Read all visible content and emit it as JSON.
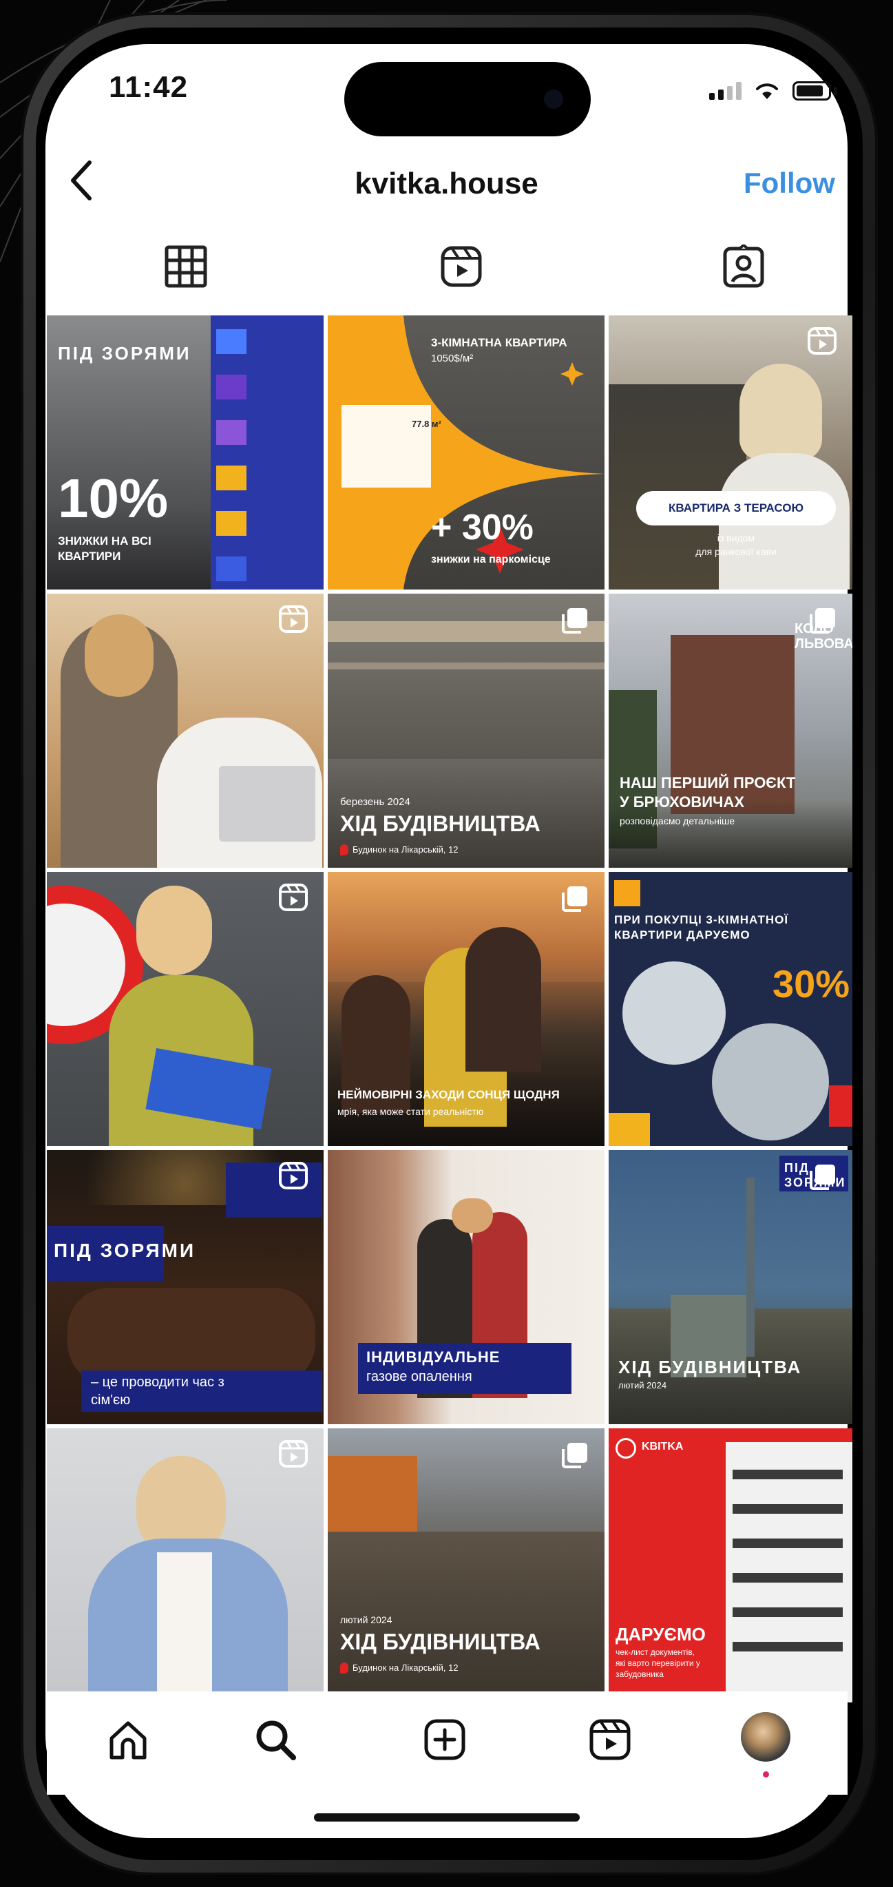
{
  "status": {
    "time": "11:42"
  },
  "header": {
    "back_icon": "chevron-left-icon",
    "username": "kvitka.house",
    "follow_label": "Follow"
  },
  "tabs": [
    {
      "name": "grid-icon",
      "active": true
    },
    {
      "name": "reels-icon",
      "active": false
    },
    {
      "name": "tagged-icon",
      "active": false
    }
  ],
  "posts": {
    "p1": {
      "logo": "ПІД ЗОРЯМИ",
      "big": "10%",
      "sub1": "ЗНИЖКИ НА ВСІ",
      "sub2": "КВАРТИРИ"
    },
    "p2": {
      "title": "3-КІМНАТНА КВАРТИРА",
      "price": "1050$/м²",
      "area": "77.8 м²",
      "big": "+ 30%",
      "sub": "знижки на паркомісце"
    },
    "p3": {
      "title": "КВАРТИРА З ТЕРАСОЮ",
      "sub1": "із видом",
      "sub2": "для ранкової кави"
    },
    "p5": {
      "date": "березень 2024",
      "title": "ХІД БУДІВНИЦТВА",
      "addr": "Будинок на Лікарській, 12"
    },
    "p6": {
      "logo1": "КОЛО",
      "logo2": "ЛЬВОВА",
      "title1": "НАШ ПЕРШИЙ ПРОЄКТ",
      "title2": "У БРЮХОВИЧАХ",
      "sub": "розповідаємо детальніше"
    },
    "p8": {
      "title": "НЕЙМОВІРНІ ЗАХОДИ СОНЦЯ ЩОДНЯ",
      "sub": "мрія, яка може стати реальністю"
    },
    "p9": {
      "title1": "ПРИ ПОКУПЦІ 3-КІМНАТНОЇ",
      "title2": "КВАРТИРИ ДАРУЄМО",
      "big": "30%"
    },
    "p10": {
      "logo": "ПІД ЗОРЯМИ",
      "sub1": "– це проводити час з",
      "sub2": "сім'єю"
    },
    "p11": {
      "title1": "ІНДИВІДУАЛЬНЕ",
      "title2": "газове опалення"
    },
    "p12": {
      "logo": "ПІД ЗОРЯМИ",
      "title": "ХІД БУДІВНИЦТВА",
      "date": "лютий 2024"
    },
    "p14": {
      "date": "лютий 2024",
      "title": "ХІД БУДІВНИЦТВА",
      "addr": "Будинок на Лікарській, 12"
    },
    "p15": {
      "logo": "KBITKA",
      "title": "ДАРУЄМО",
      "sub1": "чек-лист документів,",
      "sub2": "які варто перевірити у",
      "sub3": "забудовника"
    }
  },
  "bottom_nav": [
    {
      "name": "home-icon"
    },
    {
      "name": "search-icon"
    },
    {
      "name": "new-post-icon"
    },
    {
      "name": "reels-icon"
    },
    {
      "name": "profile-avatar"
    }
  ],
  "colors": {
    "follow": "#3b8fe0",
    "navy": "#1a237e",
    "orange": "#f6a51b",
    "red": "#e02424"
  }
}
